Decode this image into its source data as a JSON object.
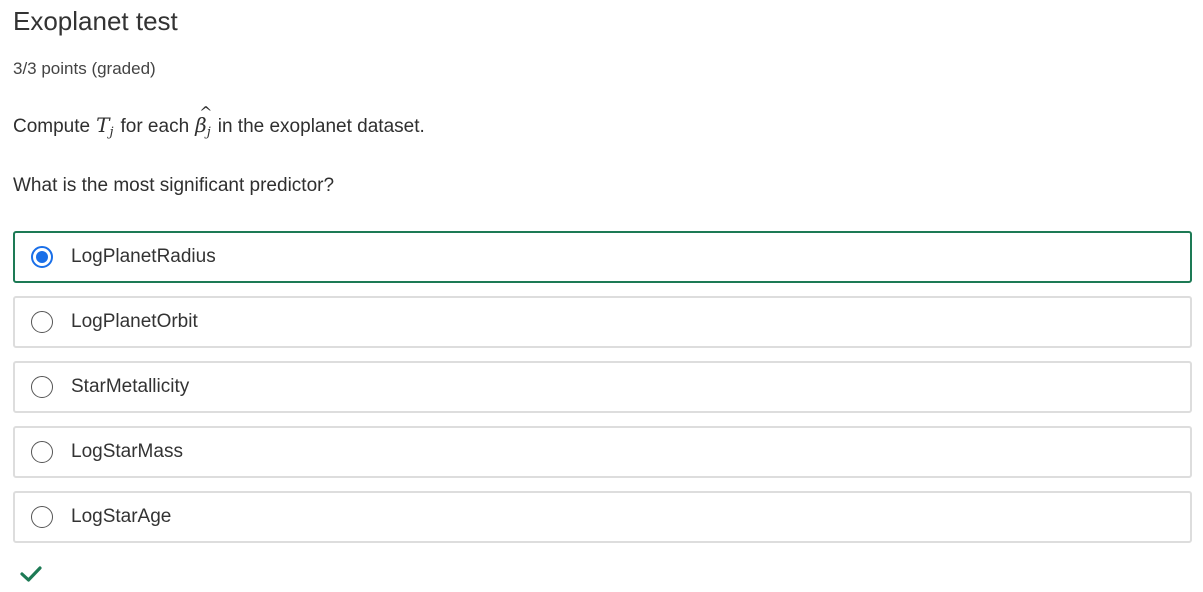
{
  "header": {
    "title": "Exoplanet test",
    "points": "3/3 points (graded)"
  },
  "question": {
    "prefix": "Compute",
    "symbol_T": "T",
    "symbol_T_sub": "j",
    "middle": "for each",
    "symbol_beta": "β",
    "symbol_beta_sub": "j",
    "suffix": "in the exoplanet dataset.",
    "prompt": "What is the most significant predictor?"
  },
  "options": [
    {
      "label": "LogPlanetRadius",
      "selected": true
    },
    {
      "label": "LogPlanetOrbit",
      "selected": false
    },
    {
      "label": "StarMetallicity",
      "selected": false
    },
    {
      "label": "LogStarMass",
      "selected": false
    },
    {
      "label": "LogStarAge",
      "selected": false
    }
  ],
  "status": {
    "icon": "checkmark-icon",
    "color": "#1d7a55"
  },
  "colors": {
    "selected_border": "#1d7a55",
    "radio_selected": "#1a6fe8"
  }
}
